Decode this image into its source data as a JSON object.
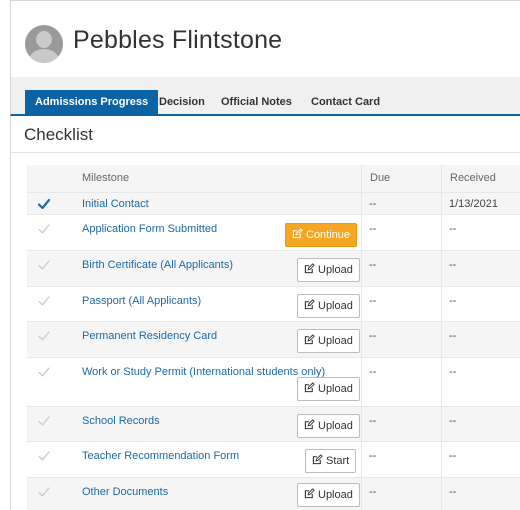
{
  "applicant": {
    "name": "Pebbles Flintstone"
  },
  "tabs": [
    {
      "label": "Admissions Progress",
      "active": true
    },
    {
      "label": "Decision",
      "active": false
    },
    {
      "label": "Official Notes",
      "active": false
    },
    {
      "label": "Contact Card",
      "active": false
    }
  ],
  "checklist": {
    "title": "Checklist",
    "columns": {
      "milestone": "Milestone",
      "due": "Due",
      "received": "Received"
    },
    "rows": [
      {
        "milestone": "Initial Contact",
        "due": "--",
        "received": "1/13/2021",
        "complete": true,
        "action": ""
      },
      {
        "milestone": "Application Form Submitted",
        "due": "--",
        "received": "--",
        "complete": false,
        "action": "Continue"
      },
      {
        "milestone": "Birth Certificate (All Applicants)",
        "due": "--",
        "received": "--",
        "complete": false,
        "action": "Upload"
      },
      {
        "milestone": "Passport (All Applicants)",
        "due": "--",
        "received": "--",
        "complete": false,
        "action": "Upload"
      },
      {
        "milestone": "Permanent Residency Card",
        "due": "--",
        "received": "--",
        "complete": false,
        "action": "Upload"
      },
      {
        "milestone": "Work or Study Permit (International students only)",
        "due": "--",
        "received": "--",
        "complete": false,
        "action": "Upload"
      },
      {
        "milestone": "School Records",
        "due": "--",
        "received": "--",
        "complete": false,
        "action": "Upload"
      },
      {
        "milestone": "Teacher Recommendation Form",
        "due": "--",
        "received": "--",
        "complete": false,
        "action": "Start"
      },
      {
        "milestone": "Other Documents",
        "due": "--",
        "received": "--",
        "complete": false,
        "action": "Upload"
      }
    ]
  },
  "colors": {
    "accent": "#0b63a6",
    "link": "#1a6aa8",
    "continue": "#f5a623",
    "check_done": "#1a6aa8",
    "check_pending": "#c8c8c8"
  },
  "icons": {
    "done": "checkmark-icon",
    "pending": "checkmark-outline-icon",
    "action": "edit-icon"
  }
}
